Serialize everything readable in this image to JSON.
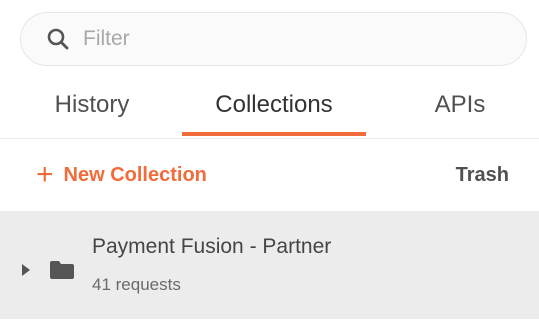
{
  "search": {
    "placeholder": "Filter",
    "value": ""
  },
  "tabs": [
    {
      "label": "History",
      "active": false
    },
    {
      "label": "Collections",
      "active": true
    },
    {
      "label": "APIs",
      "active": false
    }
  ],
  "actions": {
    "new_collection_label": "New Collection",
    "trash_label": "Trash"
  },
  "collections": [
    {
      "name": "Payment Fusion - Partner",
      "count_label": "41 requests"
    }
  ],
  "colors": {
    "accent": "#f26b3a",
    "item_bg": "#ececec"
  },
  "icons": {
    "search": "search-icon",
    "plus": "plus-icon",
    "caret": "caret-right-icon",
    "folder": "folder-icon"
  }
}
